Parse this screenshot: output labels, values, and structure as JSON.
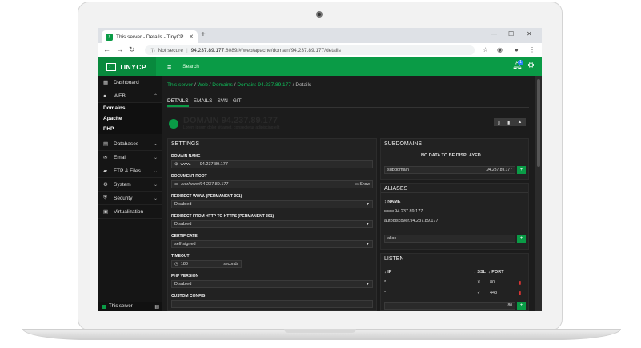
{
  "browser": {
    "tab_title": "This server - Details - TinyCP",
    "tab_close": "✕",
    "new_tab": "+",
    "minimize": "—",
    "maximize": "☐",
    "close": "✕",
    "back": "←",
    "forward": "→",
    "reload": "↻",
    "not_secure": "Not secure",
    "url_host": "94.237.89.177",
    "url_path": ":8089/#/web/apache/domain/94.237.89.177/details"
  },
  "app": {
    "brand": "TINYCP",
    "search_label": "Search",
    "notification_count": "1",
    "accent": "#0a9b46"
  },
  "sidebar": {
    "items": [
      {
        "label": "Dashboard",
        "icon": "dashboard-icon"
      },
      {
        "label": "WEB",
        "icon": "globe-icon"
      },
      {
        "label": "Databases",
        "icon": "database-icon"
      },
      {
        "label": "Email",
        "icon": "envelope-icon"
      },
      {
        "label": "FTP & Files",
        "icon": "folder-icon"
      },
      {
        "label": "System",
        "icon": "gear-icon"
      },
      {
        "label": "Security",
        "icon": "shield-icon"
      },
      {
        "label": "Virtualization",
        "icon": "server-icon"
      }
    ],
    "web_sub": [
      "Domains",
      "Apache",
      "PHP"
    ],
    "footer": "This server"
  },
  "breadcrumb": {
    "items": [
      "This server",
      "Web",
      "Domains",
      "Domain: 94.237.89.177",
      "Details"
    ]
  },
  "tabs": [
    "DETAILS",
    "EMAILS",
    "SVN",
    "GIT"
  ],
  "domain": {
    "title": "DOMAIN 94.237.89.177",
    "subtitle": "Lorem ipsum dolor sit amet, consectetur adipiscing elit"
  },
  "settings": {
    "title": "SETTINGS",
    "domain_name_label": "DOMAIN NAME",
    "domain_prefix": "www.",
    "domain_value": "94.237.89.177",
    "doc_root_label": "DOCUMENT ROOT",
    "doc_root_value": "/var/www/94.237.89.177",
    "show_label": "Show",
    "redirect_www_label": "REDIRECT WWW. (PERMANENT 301)",
    "redirect_www_value": "Disabled",
    "redirect_https_label": "REDIRECT FROM HTTP TO HTTPS (PERMANENT 301)",
    "redirect_https_value": "Disabled",
    "certificate_label": "CERTIFICATE",
    "certificate_value": "self-signed",
    "timeout_label": "TIMEOUT",
    "timeout_value": "180",
    "timeout_unit": "seconds",
    "php_label": "PHP VERSION",
    "php_value": "Disabled",
    "custom_label": "CUSTOM CONFIG"
  },
  "subdomains": {
    "title": "SUBDOMAINS",
    "empty": "NO DATA TO BE DISPLAYED",
    "input_placeholder": "subdomain",
    "suffix": ".94.237.89.177"
  },
  "aliases": {
    "title": "ALIASES",
    "col_name": "NAME",
    "rows": [
      "www.94.237.89.177",
      "autodiscover.94.237.89.177"
    ],
    "input_placeholder": "alias"
  },
  "listen": {
    "title": "LISTEN",
    "col_ip": "IP",
    "col_ssl": "SSL",
    "col_port": "PORT",
    "rows": [
      {
        "ip": "*",
        "ssl": "✕",
        "port": "80"
      },
      {
        "ip": "*",
        "ssl": "✓",
        "port": "443"
      }
    ],
    "new_port": "80"
  }
}
